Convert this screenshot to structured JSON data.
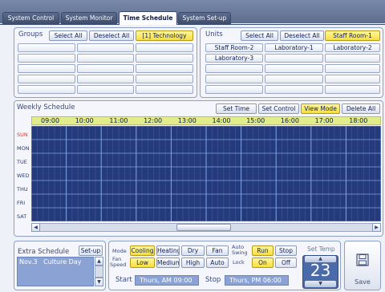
{
  "tabs": [
    "System Control",
    "System Monitor",
    "Time Schedule",
    "System Set-up"
  ],
  "groups": {
    "title": "Groups",
    "select_all": "Select All",
    "deselect_all": "Deselect All",
    "selected": "[1] Technology"
  },
  "units": {
    "title": "Units",
    "select_all": "Select All",
    "deselect_all": "Deselect All",
    "items": [
      "Staff Room-1",
      "Staff Room-2",
      "Laboratory-1",
      "Laboratory-2",
      "Laboratory-3"
    ]
  },
  "weekly": {
    "title": "Weekly Schedule",
    "set_time": "Set Time",
    "set_control": "Set Control",
    "view_mode": "View Mode",
    "delete_all": "Delete All",
    "hours": [
      "09:00",
      "10:00",
      "11:00",
      "12:00",
      "13:00",
      "14:00",
      "15:00",
      "16:00",
      "17:00",
      "18:00"
    ],
    "days": [
      "SUN",
      "MON",
      "TUE",
      "WED",
      "THU",
      "FRI",
      "SAT"
    ]
  },
  "extra": {
    "title": "Extra Schedule",
    "setup": "Set-up",
    "date": "Nov.3",
    "name": "Culture Day"
  },
  "controls": {
    "mode_label": "Mode",
    "modes": [
      "Cooling",
      "Heating",
      "Dry",
      "Fan"
    ],
    "auto_swing_1": "Auto",
    "auto_swing_2": "Swing",
    "run": "Run",
    "stop": "Stop",
    "fan_label_1": "Fan",
    "fan_label_2": "Speed",
    "speeds": [
      "Low",
      "Medium",
      "High",
      "Auto"
    ],
    "lock_label": "Lock",
    "on": "On",
    "off": "Off",
    "start_label": "Start",
    "start_value": "Thurs, AM 09:00",
    "stop_label": "Stop",
    "stop_value": "Thurs, PM 06:00",
    "set_temp_label": "Set Temp",
    "temp": "23",
    "save": "Save"
  },
  "colors": {
    "accent": "#f7de3c",
    "grid": "#253a7a",
    "header": "#e2ec8a"
  }
}
